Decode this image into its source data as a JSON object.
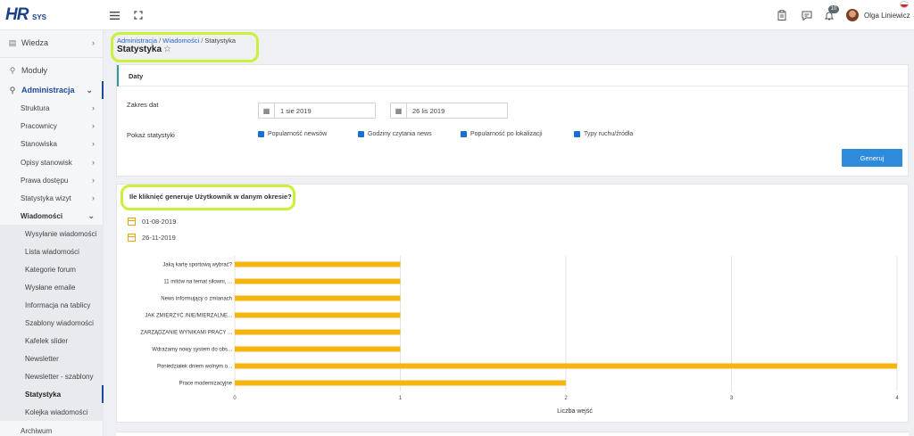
{
  "header": {
    "logo_main": "HR",
    "logo_sub": "SYS",
    "notification_count": "10",
    "user_name": "Olga Liniewicz",
    "user_caret": "⌄"
  },
  "sidebar": {
    "items": [
      {
        "label": "Wiedza"
      },
      {
        "label": "Moduły"
      },
      {
        "label": "Administracja"
      },
      {
        "label": "Struktura"
      },
      {
        "label": "Pracownicy"
      },
      {
        "label": "Stanowiska"
      },
      {
        "label": "Opisy stanowisk"
      },
      {
        "label": "Prawa dostępu"
      },
      {
        "label": "Statystyka wizyt"
      },
      {
        "label": "Wiadomości"
      },
      {
        "label": "Wysyłanie wiadomości"
      },
      {
        "label": "Lista wiadomości"
      },
      {
        "label": "Kategorie forum"
      },
      {
        "label": "Wysłane emaile"
      },
      {
        "label": "Informacja na tablicy"
      },
      {
        "label": "Szablony wiadomości"
      },
      {
        "label": "Kafelek slider"
      },
      {
        "label": "Newsletter"
      },
      {
        "label": "Newsletter - szablony"
      },
      {
        "label": "Statystyka"
      },
      {
        "label": "Kolejka wiadomości"
      },
      {
        "label": "Archiwum"
      }
    ]
  },
  "breadcrumb": {
    "part1": "Administracja",
    "sep1": " / ",
    "part2": "Wiadomości",
    "sep2": " / ",
    "part3": "Statystyka"
  },
  "page": {
    "title": "Statystyka",
    "star": "☆"
  },
  "filters": {
    "panel_title": "Daty",
    "date_range_label": "Zakres dat",
    "date_from": "1 sie 2019",
    "date_to": "26 lis 2019",
    "show_stats_label": "Pokaż statystyki",
    "options": [
      {
        "label": "Popularność newsów"
      },
      {
        "label": "Godziny czytania news"
      },
      {
        "label": "Popularność po lokalizacji"
      },
      {
        "label": "Typy ruchu/źródła"
      }
    ],
    "generate_label": "Generuj"
  },
  "stats_panel": {
    "question": "Ile kliknięć generuje Użytkownik w danym okresie?",
    "date_start": "01-08-2019",
    "date_end": "26-11-2019"
  },
  "colors": {
    "bar": "#f5b50f",
    "accent": "#2e8bdc",
    "highlight": "#c8f03c"
  },
  "chart_data": {
    "type": "bar",
    "orientation": "horizontal",
    "categories": [
      "Jaką kartę sportową wybrać?",
      "11 mitów na temat siłowni, ...",
      "News informujący o zmianach",
      "JAK ZMIERZYĆ /NIE/MIERZALNE...",
      "ZARZĄDZANIE WYNIKAMI PRACY ...",
      "Wdrażamy nowy system do obs...",
      "Poniedziałek dniem wolnym o...",
      "Prace modernizacyjne"
    ],
    "values": [
      1,
      1,
      1,
      1,
      1,
      1,
      4,
      2
    ],
    "xlabel": "Liczba wejść",
    "xlim": [
      0,
      4
    ],
    "xticks": [
      "0",
      "1",
      "2",
      "3",
      "4"
    ],
    "grid": true
  }
}
